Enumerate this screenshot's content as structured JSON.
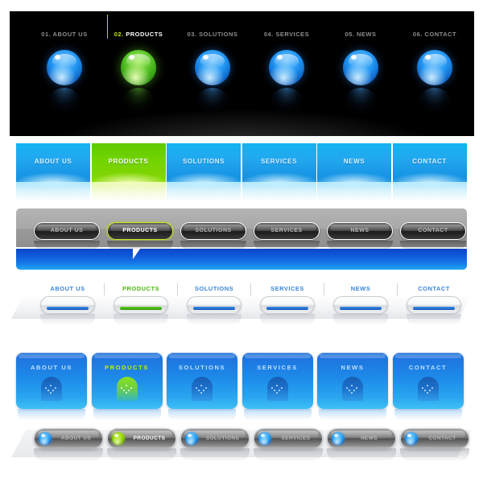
{
  "nav": {
    "items": [
      {
        "number": "01.",
        "label": "ABOUT US",
        "active": false
      },
      {
        "number": "02.",
        "label": "PRODUCTS",
        "active": true
      },
      {
        "number": "03.",
        "label": "SOLUTIONS",
        "active": false
      },
      {
        "number": "04.",
        "label": "SERVICES",
        "active": false
      },
      {
        "number": "05.",
        "label": "NEWS",
        "active": false
      },
      {
        "number": "06.",
        "label": "CONTACT",
        "active": false
      }
    ],
    "active_index": 1,
    "active_label": "PRODUCTS"
  },
  "variants": [
    {
      "id": "dark-sphere-nav",
      "name": "Dark sphere navigation",
      "background": "#000000",
      "labels": [
        "01. ABOUT US",
        "02. PRODUCTS",
        "03. SOLUTIONS",
        "04. SERVICES",
        "05. NEWS",
        "06. CONTACT"
      ],
      "numbers": [
        "01.",
        "02.",
        "03.",
        "04.",
        "05.",
        "06."
      ],
      "names": [
        "ABOUT US",
        "PRODUCTS",
        "SOLUTIONS",
        "SERVICES",
        "NEWS",
        "CONTACT"
      ],
      "accent_inactive": "#2196f3",
      "accent_active": "#56c426",
      "label_color_inactive": "#8d8d8d",
      "label_color_active": "#ffffff",
      "marker_color": "#c6e600"
    },
    {
      "id": "gradient-panel-nav",
      "name": "Gradient panel navigation",
      "labels": [
        "ABOUT US",
        "PRODUCTS",
        "SOLUTIONS",
        "SERVICES",
        "NEWS",
        "CONTACT"
      ],
      "accent_inactive": "#22a8ef",
      "accent_active": "#72d400",
      "label_color_inactive": "#d9f2ff",
      "label_color_active": "#ffffff"
    },
    {
      "id": "gray-bar-pill-nav",
      "name": "Gray bar with dark pills",
      "labels": [
        "ABOUT US",
        "PRODUCTS",
        "SOLUTIONS",
        "SERVICES",
        "NEWS",
        "CONTACT"
      ],
      "bar_color": "#a8a8a8",
      "pill_color": "#3f3f3f",
      "border_inactive": "#ffffff",
      "border_active": "#c8e81e",
      "label_color_inactive": "#b4b4b4",
      "label_color_active": "#ffffff",
      "footer_color": "#1478e8",
      "pointer": "triangle-down"
    },
    {
      "id": "white-strip-nav",
      "name": "White strip with silver pills",
      "labels": [
        "ABOUT US",
        "PRODUCTS",
        "SOLUTIONS",
        "SERVICES",
        "NEWS",
        "CONTACT"
      ],
      "label_color_inactive": "#3a86d8",
      "label_color_active": "#4fb511",
      "inner_bar_inactive": "#1459c2",
      "inner_bar_active": "#2f9a08"
    },
    {
      "id": "blue-tile-nav",
      "name": "Blue tile navigation",
      "labels": [
        "ABOUT US",
        "PRODUCTS",
        "SOLUTIONS",
        "SERVICES",
        "NEWS",
        "CONTACT"
      ],
      "tile_color": "#1d8be9",
      "label_color_inactive": "#bfe0fb",
      "label_color_active": "#c4f000",
      "icon_name": "arch-dots-icon"
    },
    {
      "id": "silver-orb-pill-nav",
      "name": "Silver pills with glossy orbs",
      "labels": [
        "ABOUT US",
        "PRODUCTS",
        "SOLUTIONS",
        "SERVICES",
        "NEWS",
        "CONTACT"
      ],
      "pill_color": "#787878",
      "orb_inactive": "#229ef5",
      "orb_active": "#8fd400",
      "label_color_inactive": "#b9b9b9",
      "label_color_active": "#ffffff"
    }
  ]
}
